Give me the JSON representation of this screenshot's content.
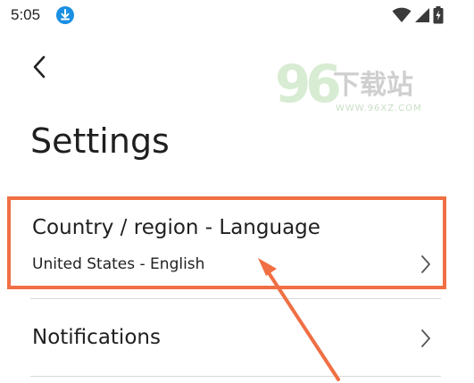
{
  "status_bar": {
    "time": "5:05",
    "download_icon": "download-circle-icon",
    "wifi_icon": "wifi-icon",
    "signal_icon": "signal-icon",
    "battery_icon": "battery-charging-icon"
  },
  "header": {
    "back_icon": "chevron-left-icon",
    "title": "Settings"
  },
  "watermark": {
    "number": "96",
    "chinese": "下载站",
    "url": "WWW.96XZ.COM"
  },
  "settings_items": [
    {
      "title": "Country / region - Language",
      "subtitle": "United States - English",
      "icon": "chevron-right-icon"
    },
    {
      "title": "Notifications",
      "icon": "chevron-right-icon"
    }
  ],
  "annotation": {
    "highlight_color": "#f06f44",
    "arrow_color": "#f06f44"
  }
}
